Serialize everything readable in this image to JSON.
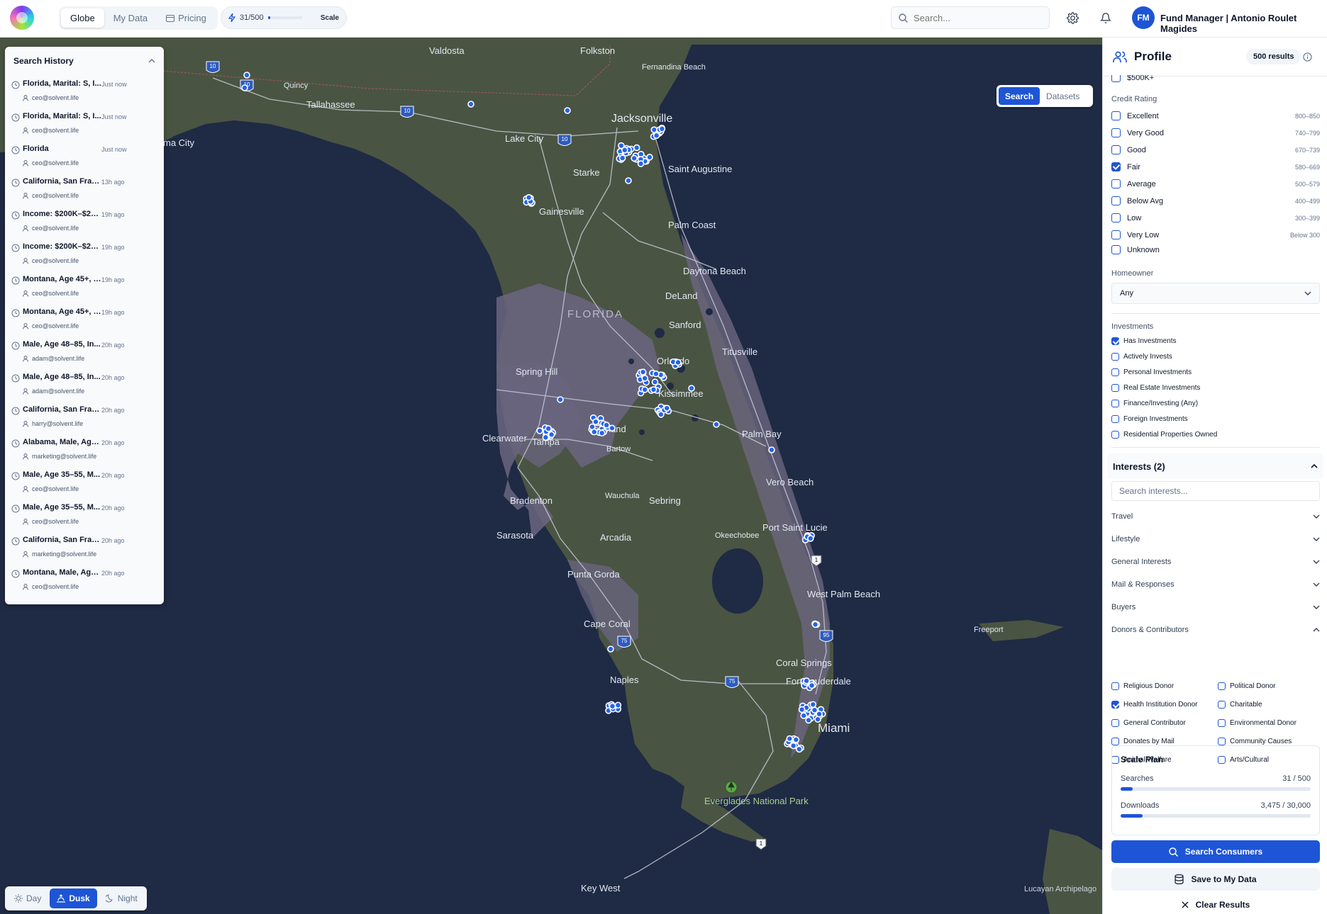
{
  "nav": {
    "tabs": [
      {
        "label": "Globe",
        "active": true
      },
      {
        "label": "My Data"
      },
      {
        "label": "Pricing"
      }
    ]
  },
  "usage": {
    "count": "31/500",
    "fraction": 0.062,
    "plan": "Scale"
  },
  "search": {
    "placeholder": "Search..."
  },
  "user": {
    "initials": "FM",
    "name": "Fund Manager | Antonio Roulet Magides"
  },
  "history": {
    "title": "Search History",
    "items": [
      {
        "query": "Florida, Marital: S, I...",
        "time": "Just now",
        "user": "ceo@solvent.life"
      },
      {
        "query": "Florida, Marital: S, I...",
        "time": "Just now",
        "user": "ceo@solvent.life"
      },
      {
        "query": "Florida",
        "time": "Just now",
        "user": "ceo@solvent.life"
      },
      {
        "query": "California, San Franc...",
        "time": "13h ago",
        "user": "ceo@solvent.life"
      },
      {
        "query": "Income: $200K–$25...",
        "time": "19h ago",
        "user": "ceo@solvent.life"
      },
      {
        "query": "Income: $200K–$25...",
        "time": "19h ago",
        "user": "ceo@solvent.life"
      },
      {
        "query": "Montana, Age 45+, I...",
        "time": "19h ago",
        "user": "ceo@solvent.life"
      },
      {
        "query": "Montana, Age 45+, I...",
        "time": "19h ago",
        "user": "ceo@solvent.life"
      },
      {
        "query": "Male, Age 48–85, In...",
        "time": "20h ago",
        "user": "adam@solvent.life"
      },
      {
        "query": "Male, Age 48–85, In...",
        "time": "20h ago",
        "user": "adam@solvent.life"
      },
      {
        "query": "California, San Franc...",
        "time": "20h ago",
        "user": "harry@solvent.life"
      },
      {
        "query": "Alabama, Male, Age ...",
        "time": "20h ago",
        "user": "marketing@solvent.life"
      },
      {
        "query": "Male, Age 35–55, M...",
        "time": "20h ago",
        "user": "ceo@solvent.life"
      },
      {
        "query": "Male, Age 35–55, M...",
        "time": "20h ago",
        "user": "ceo@solvent.life"
      },
      {
        "query": "California, San Franc...",
        "time": "20h ago",
        "user": "marketing@solvent.life"
      },
      {
        "query": "Montana, Male, Age...",
        "time": "20h ago",
        "user": "ceo@solvent.life"
      }
    ]
  },
  "map_toggle": {
    "search": "Search",
    "datasets": "Datasets"
  },
  "map_modes": [
    {
      "label": "Day"
    },
    {
      "label": "Dusk",
      "active": true
    },
    {
      "label": "Night"
    }
  ],
  "map_labels": {
    "valdosta": "Valdosta",
    "folkston": "Folkston",
    "fernandina": "Fernandina Beach",
    "quincy": "Quincy",
    "tallahassee": "Tallahassee",
    "jacksonville": "Jacksonville",
    "lakecity": "Lake City",
    "pcity": "ma City",
    "starke": "Starke",
    "staug": "Saint Augustine",
    "gainesville": "Gainesville",
    "palmcoast": "Palm Coast",
    "daytona": "Daytona Beach",
    "florida": "FLORIDA",
    "deland": "DeLand",
    "sanford": "Sanford",
    "titusville": "Titusville",
    "orlando": "Orlando",
    "kissimmee": "Kissimmee",
    "springhill": "Spring Hill",
    "clearwater": "Clearwater",
    "tampa": "Tampa",
    "lakeland": "Lakeland",
    "bartow": "Bartow",
    "palmbay": "Palm Bay",
    "verobeach": "Vero Beach",
    "wauchula": "Wauchula",
    "bradenton": "Bradenton",
    "sebring": "Sebring",
    "sarasota": "Sarasota",
    "arcadia": "Arcadia",
    "okeechobee": "Okeechobee",
    "pstlucie": "Port Saint Lucie",
    "puntagorda": "Punta Gorda",
    "wpb": "West Palm Beach",
    "capecoral": "Cape Coral",
    "freeport": "Freeport",
    "coralsprings": "Coral Springs",
    "ftl": "Fort Lauderdale",
    "naples": "Naples",
    "miami": "Miami",
    "everglades": "Everglades National Park",
    "keywest": "Key West",
    "lucayan": "Lucayan Archipelago",
    "i10": "10",
    "i75": "75",
    "i95": "95",
    "us1": "1"
  },
  "profile": {
    "title": "Profile",
    "results": "500 results",
    "income_partial": "$500K+",
    "credit_rating": {
      "label": "Credit Rating",
      "options": [
        {
          "label": "Excellent",
          "range": "800–850",
          "checked": false
        },
        {
          "label": "Very Good",
          "range": "740–799",
          "checked": false
        },
        {
          "label": "Good",
          "range": "670–739",
          "checked": false
        },
        {
          "label": "Fair",
          "range": "580–669",
          "checked": true
        },
        {
          "label": "Average",
          "range": "500–579",
          "checked": false
        },
        {
          "label": "Below Avg",
          "range": "400–499",
          "checked": false
        },
        {
          "label": "Low",
          "range": "300–399",
          "checked": false
        },
        {
          "label": "Very Low",
          "range": "Below 300",
          "checked": false
        },
        {
          "label": "Unknown",
          "range": "",
          "checked": false
        }
      ]
    },
    "homeowner": {
      "label": "Homeowner",
      "value": "Any"
    },
    "investments": {
      "label": "Investments",
      "options": [
        {
          "label": "Has Investments",
          "checked": true
        },
        {
          "label": "Actively Invests",
          "checked": false
        },
        {
          "label": "Personal Investments",
          "checked": false
        },
        {
          "label": "Real Estate Investments",
          "checked": false
        },
        {
          "label": "Finance/Investing (Any)",
          "checked": false
        },
        {
          "label": "Foreign Investments",
          "checked": false
        },
        {
          "label": "Residential Properties Owned",
          "checked": false
        }
      ]
    },
    "interests": {
      "title": "Interests (2)",
      "placeholder": "Search interests...",
      "categories": [
        "Travel",
        "Lifestyle",
        "General Interests",
        "Mail & Responses",
        "Buyers",
        "Donors & Contributors"
      ],
      "donors": [
        {
          "label": "Religious Donor",
          "checked": false
        },
        {
          "label": "Political Donor",
          "checked": false
        },
        {
          "label": "Health Institution Donor",
          "checked": true
        },
        {
          "label": "Charitable",
          "checked": false
        },
        {
          "label": "General Contributor",
          "checked": false
        },
        {
          "label": "Environmental Donor",
          "checked": false
        },
        {
          "label": "Donates by Mail",
          "checked": false
        },
        {
          "label": "Community Causes",
          "checked": false
        },
        {
          "label": "Animal Welfare",
          "checked": false
        },
        {
          "label": "Arts/Cultural",
          "checked": false
        }
      ]
    },
    "plan": {
      "title": "Scale Plan",
      "searches_label": "Searches",
      "searches_value": "31 / 500",
      "searches_fraction": 0.062,
      "downloads_label": "Downloads",
      "downloads_value": "3,475 / 30,000",
      "downloads_fraction": 0.116
    },
    "buttons": {
      "search": "Search Consumers",
      "save": "Save to My Data",
      "clear": "Clear Results"
    }
  },
  "colors": {
    "accent": "#1e55d6",
    "water": "#1f2a44",
    "land": "#4a5443",
    "urban": "#6b6580"
  }
}
